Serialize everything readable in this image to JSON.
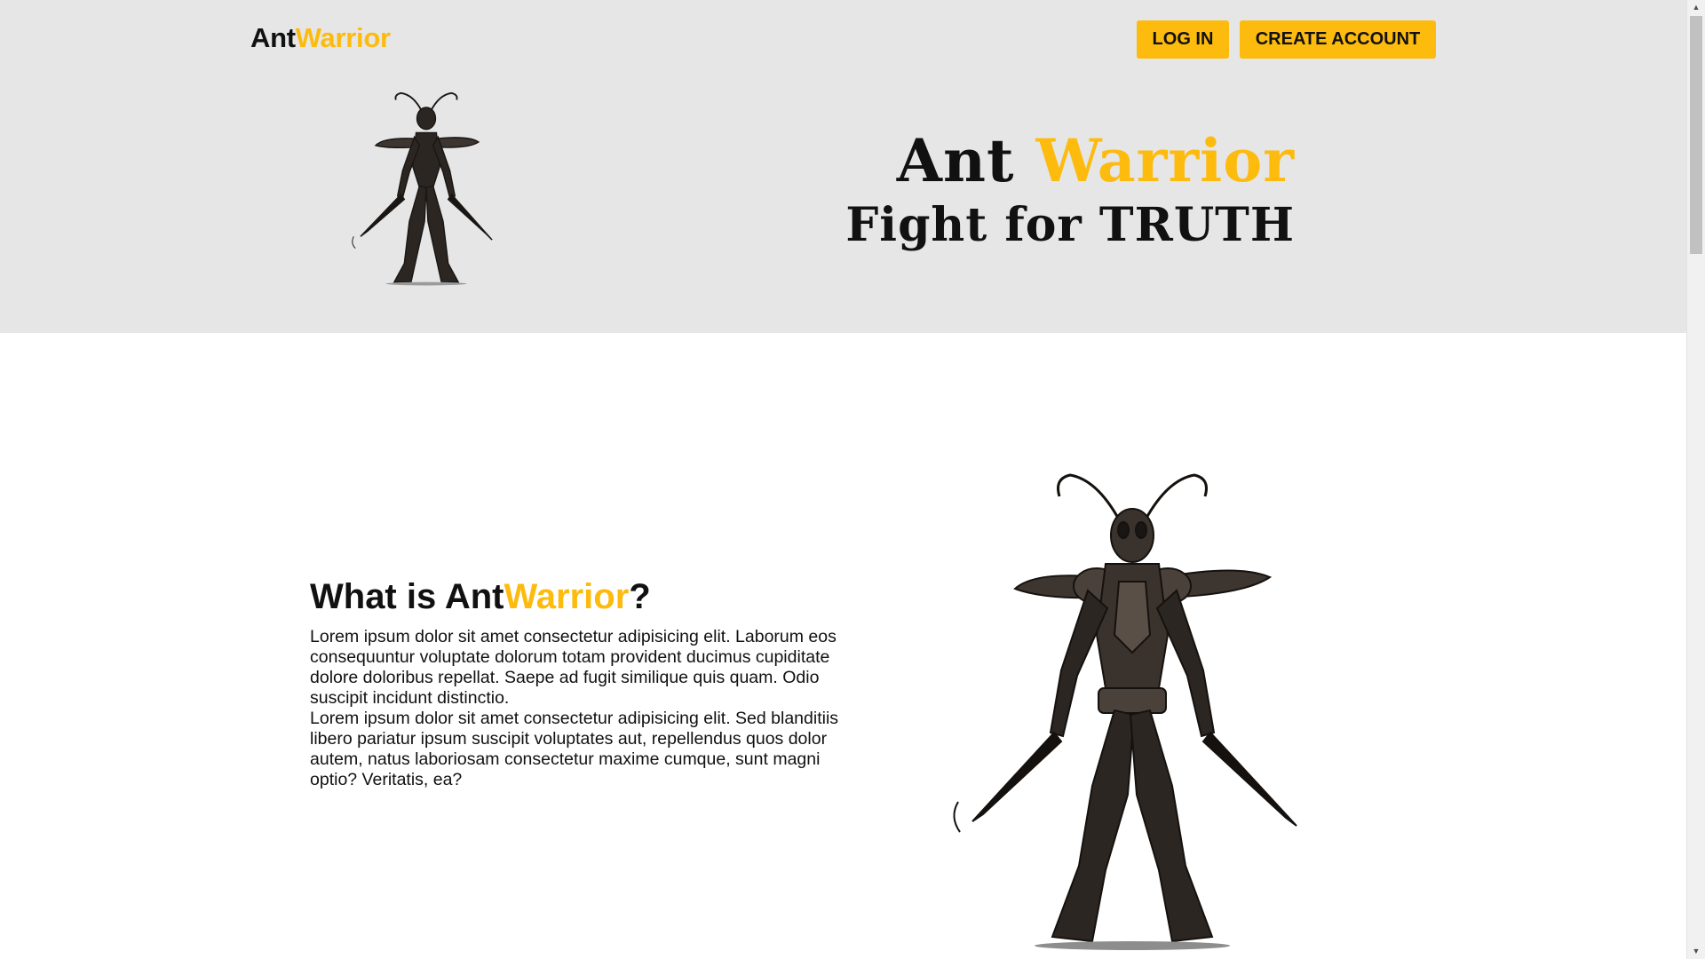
{
  "header": {
    "logo_part1": "Ant",
    "logo_part2": "Warrior",
    "login_label": "LOG IN",
    "create_account_label": "CREATE ACCOUNT"
  },
  "hero": {
    "title_part1": "Ant",
    "title_part2": "Warrior",
    "tagline": "Fight for TRUTH",
    "figure_icon": "ant-warrior-illustration"
  },
  "about": {
    "heading_part1": "What is ",
    "heading_part2": "Ant",
    "heading_part3": "Warrior",
    "heading_part4": "?",
    "paragraph1": "Lorem ipsum dolor sit amet consectetur adipisicing elit. Laborum eos consequuntur voluptate dolorum totam provident ducimus cupiditate dolore doloribus repellat. Saepe ad fugit similique quis quam. Odio suscipit incidunt distinctio.",
    "paragraph2": "Lorem ipsum dolor sit amet consectetur adipisicing elit. Sed blanditiis libero pariatur ipsum suscipit voluptates aut, repellendus quos dolor autem, natus laboriosam consectetur maxime cumque, sunt magni optio? Veritatis, ea?",
    "figure_icon": "ant-warrior-illustration"
  },
  "colors": {
    "accent": "#fdbb0e",
    "hero_background": "#e6e6e6",
    "text": "#111111"
  }
}
